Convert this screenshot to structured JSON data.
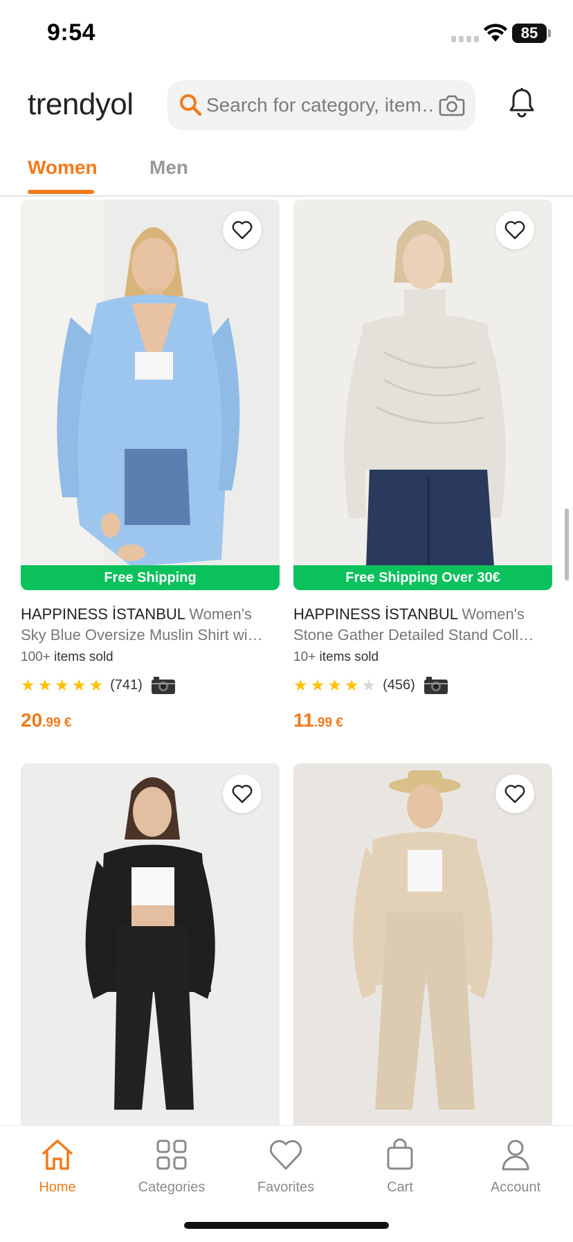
{
  "status": {
    "time": "9:54",
    "battery": "85"
  },
  "header": {
    "logo": "trendyol",
    "search_placeholder": "Search for category, item…"
  },
  "tabs": [
    {
      "label": "Women",
      "active": true
    },
    {
      "label": "Men",
      "active": false
    }
  ],
  "products": [
    {
      "brand": "HAPPINESS İSTANBUL",
      "name_line1": "Women's",
      "name_line2": "Sky Blue Oversize Muslin Shirt wi…",
      "badge": "Free Shipping",
      "sold_num": "100+",
      "sold_text": "items sold",
      "rating": 5,
      "rating_count": "(741)",
      "price_int": "20",
      "price_dec": ".99 €"
    },
    {
      "brand": "HAPPINESS İSTANBUL",
      "name_line1": "Women's",
      "name_line2": "Stone Gather Detailed Stand Coll…",
      "badge": "Free Shipping Over 30€",
      "sold_num": "10+",
      "sold_text": "items sold",
      "rating": 4,
      "rating_count": "(456)",
      "price_int": "11",
      "price_dec": ".99 €"
    }
  ],
  "bottom_nav": [
    {
      "label": "Home",
      "active": true
    },
    {
      "label": "Categories",
      "active": false
    },
    {
      "label": "Favorites",
      "active": false
    },
    {
      "label": "Cart",
      "active": false
    },
    {
      "label": "Account",
      "active": false
    }
  ],
  "colors": {
    "accent": "#f27a1a",
    "shipping_badge": "#0bc15c",
    "star": "#ffc000"
  }
}
